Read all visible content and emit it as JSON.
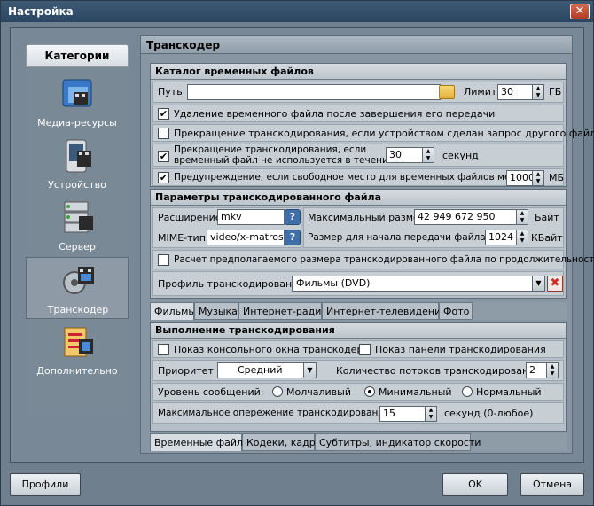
{
  "window": {
    "title": "Настройка",
    "close": "✕"
  },
  "categories": {
    "header": "Категории",
    "items": [
      {
        "label": "Медиа-ресурсы"
      },
      {
        "label": "Устройство"
      },
      {
        "label": "Сервер"
      },
      {
        "label": "Транскодер"
      },
      {
        "label": "Дополнительно"
      }
    ]
  },
  "content": {
    "title": "Транскодер",
    "temp": {
      "header": "Каталог временных файлов",
      "path_label": "Путь",
      "path_value": "",
      "limit_label": "Лимит",
      "limit_value": "30",
      "limit_unit": "ГБ",
      "delete_temp": "Удаление временного файла после завершения его передачи",
      "stop_on_request": "Прекращение транскодирования, если устройством сделан запрос другого файла",
      "stop_unused_line1": "Прекращение транскодирования, если",
      "stop_unused_line2": "временный файл не используется в течении",
      "stop_unused_value": "30",
      "stop_unused_unit": "секунд",
      "warn_label": "Предупреждение, если свободное место для временных файлов меньше",
      "warn_value": "1000",
      "warn_unit": "МБ"
    },
    "params": {
      "header": "Параметры транскодированного файла",
      "ext_label": "Расширение",
      "ext_value": "mkv",
      "mime_label": "MIME-тип",
      "mime_value": "video/x-matroska",
      "help": "?",
      "max_size_label": "Максимальный размер",
      "max_size_value": "42 949 672 950",
      "max_size_unit": "Байт",
      "start_size_label": "Размер для начала передачи файла",
      "start_size_value": "1024",
      "start_size_unit": "КБайт",
      "calc_label": "Расчет предполагаемого размера транскодированного файла по продолжительности",
      "profile_label": "Профиль транскодирования",
      "profile_value": "Фильмы (DVD)"
    },
    "media_tabs": [
      "Фильмы",
      "Музыка",
      "Интернет-радио",
      "Интернет-телевидение",
      "Фото"
    ],
    "exec": {
      "header": "Выполнение транскодирования",
      "console_label": "Показ консольного окна транскодера",
      "panel_label": "Показ панели транскодирования",
      "priority_label": "Приоритет",
      "priority_value": "Средний",
      "threads_label": "Количество потоков транскодирования",
      "threads_value": "2",
      "log_label": "Уровень сообщений:",
      "log_options": [
        "Молчаливый",
        "Минимальный",
        "Нормальный"
      ],
      "ahead_label": "Максимальное опережение транскодирования",
      "ahead_value": "15",
      "ahead_unit": "секунд (0-любое)"
    },
    "bottom_tabs": [
      "Временные файлы",
      "Кодеки, кадр",
      "Субтитры, индикатор скорости"
    ]
  },
  "buttons": {
    "profiles": "Профили",
    "ok": "OK",
    "cancel": "Отмена"
  },
  "glyphs": {
    "check": "✔",
    "up": "▲",
    "down": "▼",
    "dropdown": "▼",
    "delete": "✖"
  }
}
